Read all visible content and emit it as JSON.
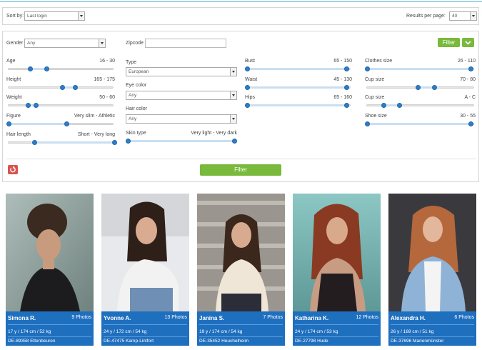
{
  "sort": {
    "label": "Sort by:",
    "value": "Last login",
    "results_label": "Results per page:",
    "results_value": "40"
  },
  "filters": {
    "gender_label": "Gender",
    "gender_value": "Any",
    "zipcode_label": "Zipcode",
    "zipcode_value": "",
    "filter_top_label": "Filter",
    "type_label": "Type",
    "type_value": "European",
    "eye_color_label": "Eye color",
    "eye_color_value": "Any",
    "hair_color_label": "Hair color",
    "hair_color_value": "Any",
    "skin_type_label": "Skin type",
    "skin_type_range": "Very light - Very dark",
    "filter_bottom_label": "Filter",
    "reset_icon": "undo-icon",
    "sliders": [
      {
        "label": "Age",
        "range": "16 - 30",
        "from": 0.2,
        "to": 0.36
      },
      {
        "label": "Height",
        "range": "165 - 175",
        "from": 0.51,
        "to": 0.63
      },
      {
        "label": "Weight",
        "range": "50 - 60",
        "from": 0.18,
        "to": 0.26
      },
      {
        "label": "Figure",
        "range": "Very slim - Athletic",
        "from": 0.0,
        "to": 0.55
      },
      {
        "label": "Hair length",
        "range": "Short - Very long",
        "from": 0.24,
        "to": 1.0
      },
      {
        "label": "Bust",
        "range": "65 - 150",
        "from": 0.0,
        "to": 0.95
      },
      {
        "label": "Waist",
        "range": "45 - 130",
        "from": 0.0,
        "to": 0.95
      },
      {
        "label": "Hips",
        "range": "65 - 160",
        "from": 0.0,
        "to": 0.95
      },
      {
        "label": "Clothes size",
        "range": "26 - 110",
        "from": 0.0,
        "to": 0.96
      },
      {
        "label": "Cup size",
        "range": "70 - 80",
        "from": 0.47,
        "to": 0.62
      },
      {
        "label": "Cup size",
        "range": "A - C",
        "from": 0.15,
        "to": 0.3
      },
      {
        "label": "Shoe size",
        "range": "30 - 55",
        "from": 0.0,
        "to": 0.96
      }
    ]
  },
  "models": [
    {
      "name": "Simona R.",
      "photos": "9 Photos",
      "stats": "17 y / 174 cm / 52 kg",
      "location": "DE-89358 Ettenbeuren"
    },
    {
      "name": "Yvonne A.",
      "photos": "13 Photos",
      "stats": "24 y / 172 cm / 54 kg",
      "location": "DE-47475 Kamp-Lintfort"
    },
    {
      "name": "Janina S.",
      "photos": "7 Photos",
      "stats": "19 y / 174 cm / 54 kg",
      "location": "DE-35452 Heuchelheim"
    },
    {
      "name": "Katharina K.",
      "photos": "12 Photos",
      "stats": "24 y / 174 cm / 53 kg",
      "location": "DE-27798 Hude"
    },
    {
      "name": "Alexandra H.",
      "photos": "6 Photos",
      "stats": "26 y / 169 cm / 51 kg",
      "location": "DE-37696 Marienmünster"
    }
  ],
  "colors": {
    "accent": "#2f7dc8",
    "card_bg": "#1f6fbf",
    "button_green": "#79b93b",
    "reset_red": "#d9534f"
  }
}
